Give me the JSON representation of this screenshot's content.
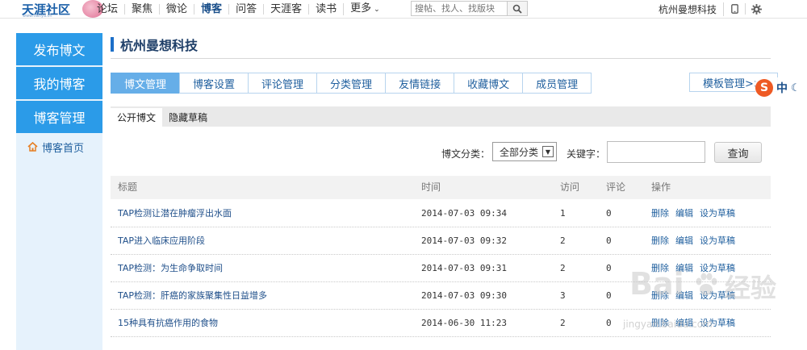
{
  "header": {
    "logo_text": "天涯社区",
    "logo_sub": "www.tianya.cn",
    "nav": [
      {
        "label": "论坛"
      },
      {
        "label": "聚焦"
      },
      {
        "label": "微论"
      },
      {
        "label": "博客",
        "active": true
      },
      {
        "label": "问答"
      },
      {
        "label": "天涯客"
      },
      {
        "label": "读书"
      },
      {
        "label": "更多"
      }
    ],
    "search_placeholder": "搜帖、找人、找版块",
    "user_name": "杭州曼想科技"
  },
  "sidebar": {
    "buttons": [
      "发布博文",
      "我的博客",
      "博客管理"
    ],
    "link_home": "博客首页"
  },
  "main": {
    "title": "杭州曼想科技",
    "tabs": [
      "博文管理",
      "博客设置",
      "评论管理",
      "分类管理",
      "友情链接",
      "收藏博文",
      "成员管理"
    ],
    "tab_template": "模板管理>>",
    "subtabs": [
      "公开博文",
      "隐藏草稿"
    ],
    "filter": {
      "category_label": "博文分类：",
      "category_value": "全部分类",
      "keyword_label": "关键字：",
      "keyword_value": "",
      "query_button": "查询"
    },
    "table": {
      "headers": [
        "标题",
        "时间",
        "访问",
        "评论",
        "操作"
      ],
      "ops": [
        "删除",
        "编辑",
        "设为草稿"
      ],
      "rows": [
        {
          "title": "TAP检测让潜在肿瘤浮出水面",
          "time": "2014-07-03 09:34",
          "visits": "1",
          "comments": "0"
        },
        {
          "title": "TAP进入临床应用阶段",
          "time": "2014-07-03 09:32",
          "visits": "2",
          "comments": "0"
        },
        {
          "title": "TAP检测：为生命争取时间",
          "time": "2014-07-03 09:31",
          "visits": "2",
          "comments": "0"
        },
        {
          "title": "TAP检测：肝癌的家族聚集性日益增多",
          "time": "2014-07-03 09:30",
          "visits": "3",
          "comments": "0"
        },
        {
          "title": "15种具有抗癌作用的食物",
          "time": "2014-06-30 11:23",
          "visits": "2",
          "comments": "0"
        }
      ]
    }
  },
  "overlay": {
    "ime_s": "S",
    "ime_lang": "中",
    "watermark": "Bai",
    "watermark_jy": "经验",
    "watermark_url": "jingyan.baidu.com"
  },
  "colors": {
    "sidebar_button": "#2b9be8",
    "tab_active": "#66aee8",
    "link": "#1f5f9e"
  }
}
